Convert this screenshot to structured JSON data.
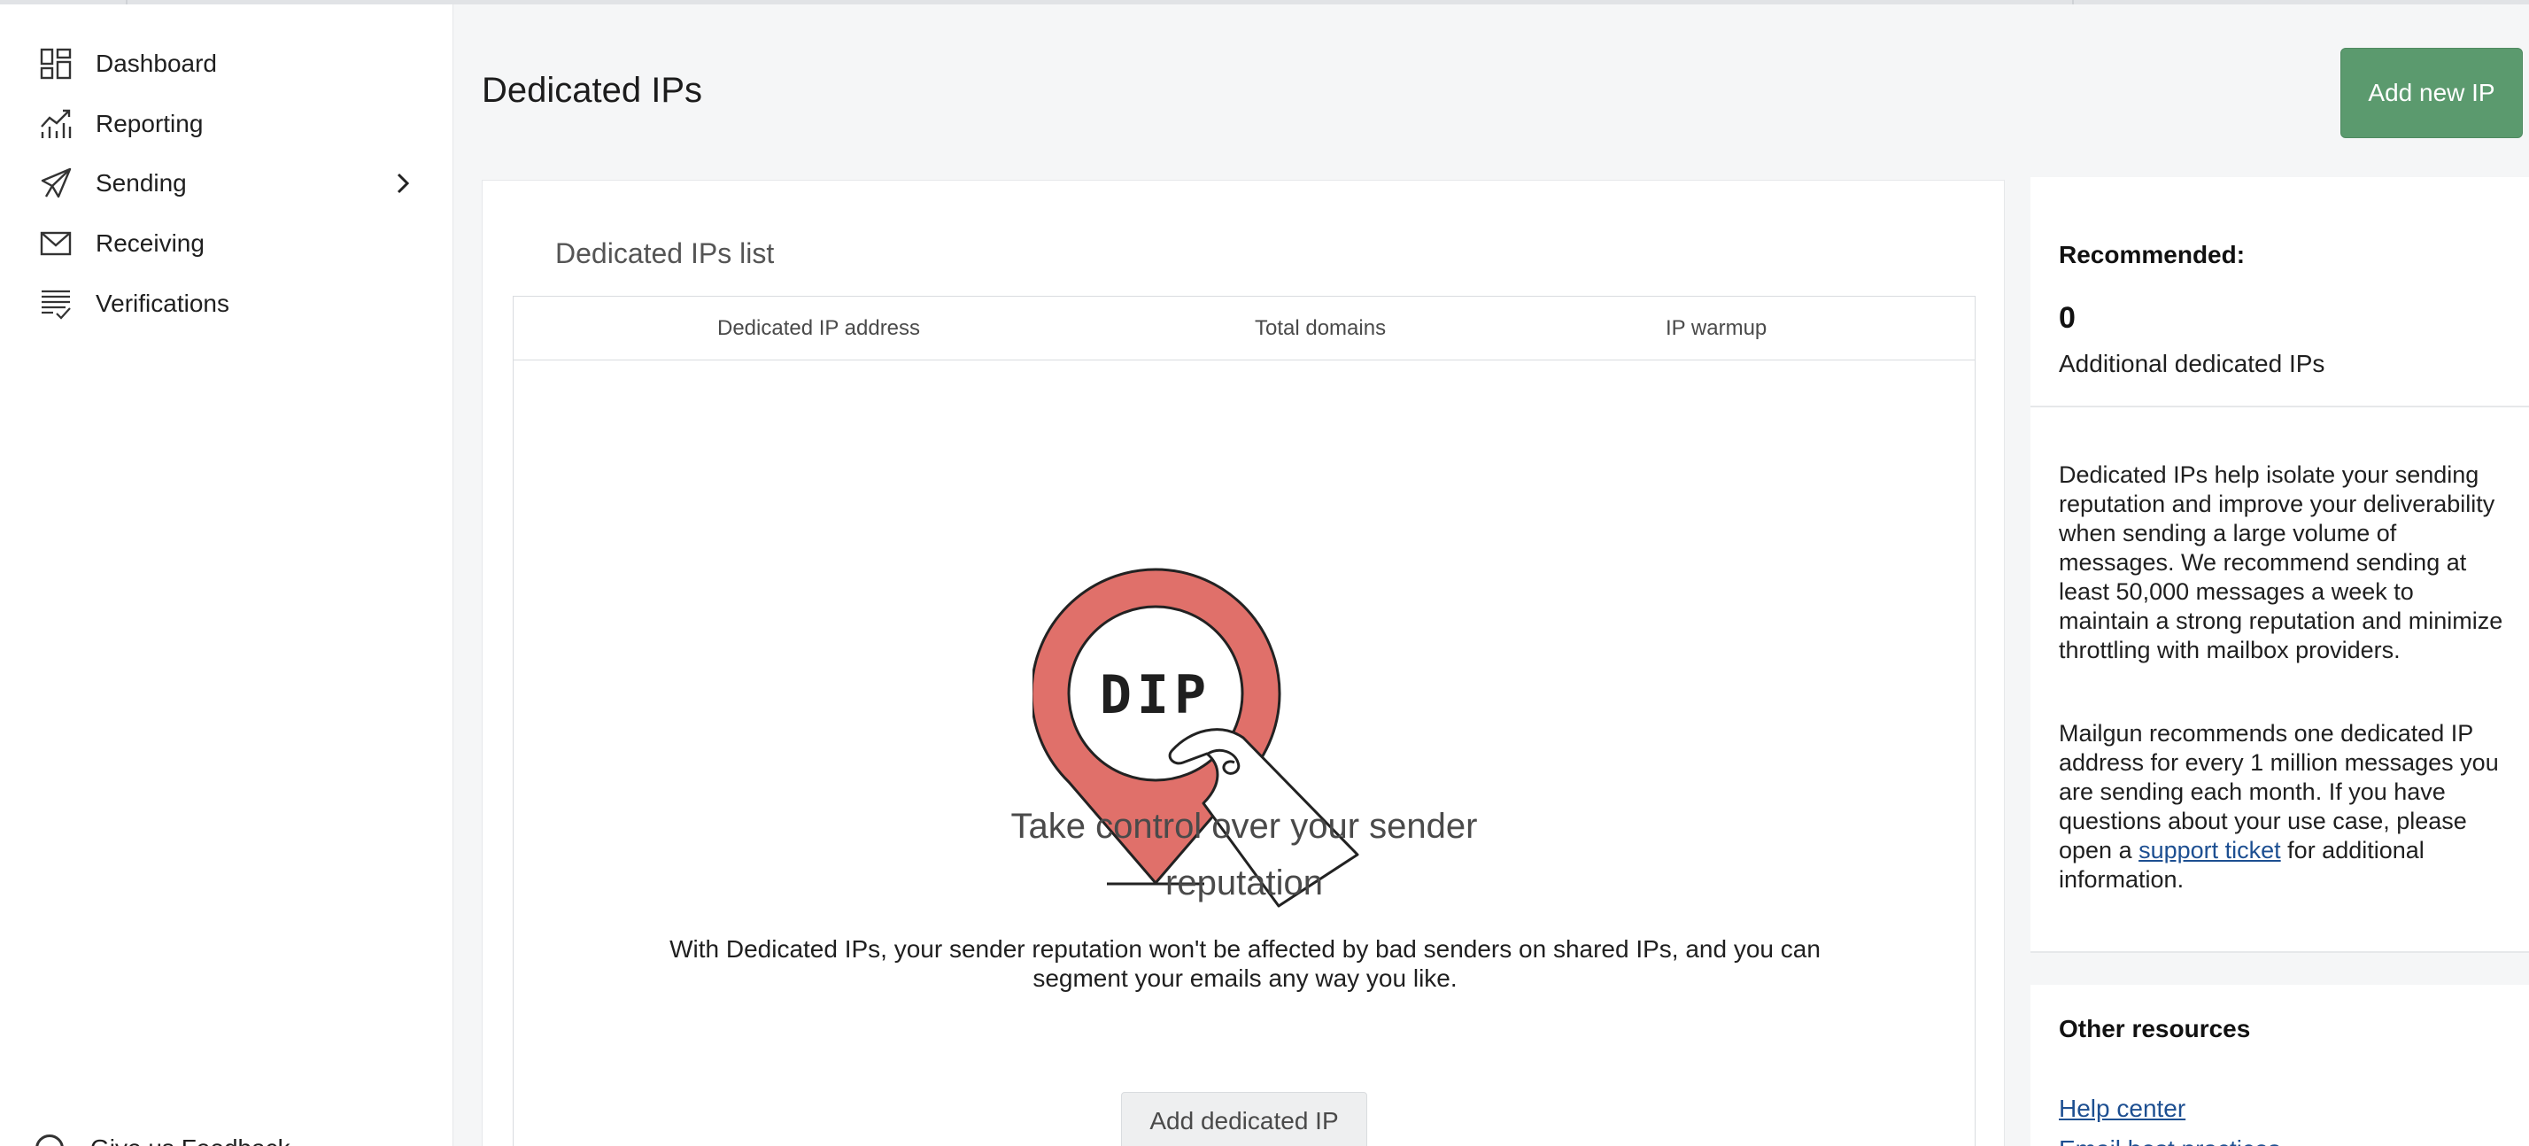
{
  "sidebar": {
    "items": [
      {
        "label": "Dashboard",
        "icon": "dashboard-icon"
      },
      {
        "label": "Reporting",
        "icon": "reporting-chart-icon"
      },
      {
        "label": "Sending",
        "icon": "paper-plane-icon",
        "has_submenu": true
      },
      {
        "label": "Receiving",
        "icon": "envelope-icon"
      },
      {
        "label": "Verifications",
        "icon": "list-check-icon"
      }
    ],
    "bottom_item": {
      "label": "Give us Feedback",
      "icon": "feedback-icon"
    }
  },
  "header": {
    "title": "Dedicated IPs",
    "add_button_label": "Add new IP"
  },
  "main": {
    "card_title": "Dedicated IPs list",
    "columns": [
      "Dedicated IP address",
      "Total domains",
      "IP warmup"
    ],
    "illustration_text": "DIP",
    "empty_title": "Take control over your sender reputation",
    "empty_description": "With Dedicated IPs, your sender reputation won't be affected by bad senders on shared IPs, and you can segment your emails any way you like.",
    "add_dedicated_label": "Add dedicated IP"
  },
  "right_panel": {
    "recommended_heading": "Recommended:",
    "recommended_count": "0",
    "recommended_label": "Additional dedicated IPs",
    "para1": "Dedicated IPs help isolate your sending reputation and improve your deliverability when sending a large volume of messages. We recommend sending at least 50,000 messages a week to maintain a strong reputation and minimize throttling with mailbox providers.",
    "para2_before": "Mailgun recommends one dedicated IP address for every 1 million messages you are sending each month. If you have questions about your use case, please open a ",
    "para2_link": "support ticket",
    "para2_after": " for additional information.",
    "resources_heading": "Other resources",
    "resources": [
      "Help center",
      "Email best practices"
    ]
  },
  "colors": {
    "primary_button": "#5b9a6e",
    "pin": "#e0706a",
    "link": "#1d4f91"
  }
}
